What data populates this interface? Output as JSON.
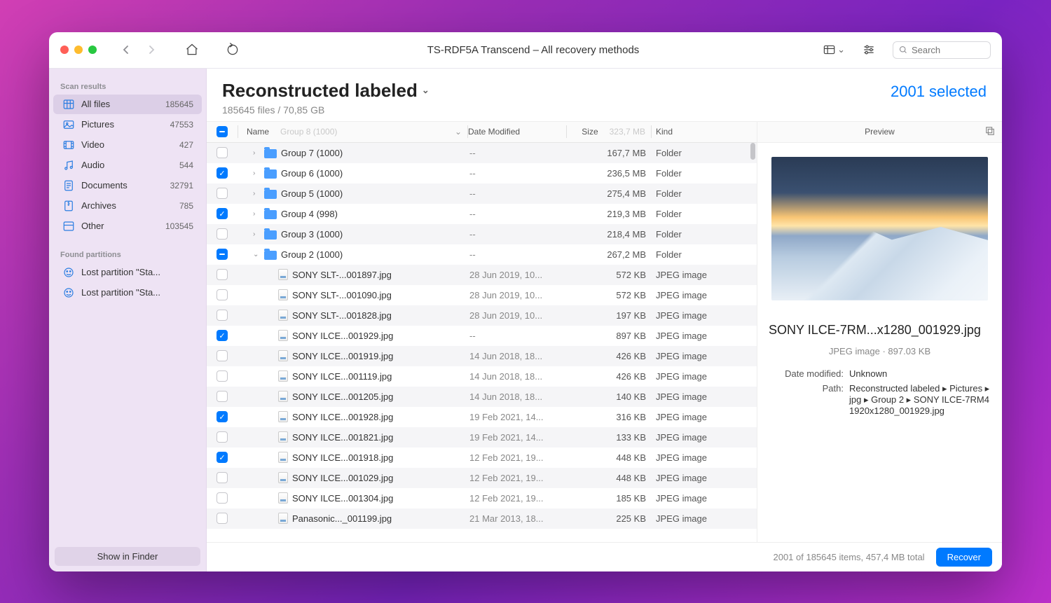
{
  "window": {
    "title": "TS-RDF5A Transcend – All recovery methods"
  },
  "toolbar": {
    "search_placeholder": "Search"
  },
  "sidebar": {
    "section_scan": "Scan results",
    "section_found": "Found partitions",
    "items": [
      {
        "icon": "grid",
        "label": "All files",
        "count": "185645",
        "active": true
      },
      {
        "icon": "picture",
        "label": "Pictures",
        "count": "47553",
        "active": false
      },
      {
        "icon": "video",
        "label": "Video",
        "count": "427",
        "active": false
      },
      {
        "icon": "audio",
        "label": "Audio",
        "count": "544",
        "active": false
      },
      {
        "icon": "document",
        "label": "Documents",
        "count": "32791",
        "active": false
      },
      {
        "icon": "archive",
        "label": "Archives",
        "count": "785",
        "active": false
      },
      {
        "icon": "other",
        "label": "Other",
        "count": "103545",
        "active": false
      }
    ],
    "partitions": [
      {
        "label": "Lost partition \"Sta..."
      },
      {
        "label": "Lost partition \"Sta..."
      }
    ],
    "footer_btn": "Show in Finder"
  },
  "header": {
    "title": "Reconstructed labeled",
    "subtitle": "185645 files / 70,85 GB",
    "selected": "2001 selected"
  },
  "columns": {
    "name": "Name",
    "name_ghost": "Group 8 (1000)",
    "date": "Date Modified",
    "size": "Size",
    "size_ghost": "323,7 MB",
    "kind": "Kind"
  },
  "rows": [
    {
      "check": "none",
      "indent": 1,
      "expand": "right",
      "type": "folder",
      "name": "Group 7 (1000)",
      "date": "--",
      "size": "167,7 MB",
      "kind": "Folder"
    },
    {
      "check": "checked",
      "indent": 1,
      "expand": "right",
      "type": "folder",
      "name": "Group 6 (1000)",
      "date": "--",
      "size": "236,5 MB",
      "kind": "Folder"
    },
    {
      "check": "none",
      "indent": 1,
      "expand": "right",
      "type": "folder",
      "name": "Group 5 (1000)",
      "date": "--",
      "size": "275,4 MB",
      "kind": "Folder"
    },
    {
      "check": "checked",
      "indent": 1,
      "expand": "right",
      "type": "folder",
      "name": "Group 4 (998)",
      "date": "--",
      "size": "219,3 MB",
      "kind": "Folder"
    },
    {
      "check": "none",
      "indent": 1,
      "expand": "right",
      "type": "folder",
      "name": "Group 3 (1000)",
      "date": "--",
      "size": "218,4 MB",
      "kind": "Folder"
    },
    {
      "check": "mixed",
      "indent": 1,
      "expand": "down",
      "type": "folder",
      "name": "Group 2 (1000)",
      "date": "--",
      "size": "267,2 MB",
      "kind": "Folder"
    },
    {
      "check": "none",
      "indent": 2,
      "expand": "",
      "type": "jpg",
      "name": "SONY SLT-...001897.jpg",
      "date": "28 Jun 2019, 10...",
      "size": "572 KB",
      "kind": "JPEG image"
    },
    {
      "check": "none",
      "indent": 2,
      "expand": "",
      "type": "jpg",
      "name": "SONY SLT-...001090.jpg",
      "date": "28 Jun 2019, 10...",
      "size": "572 KB",
      "kind": "JPEG image"
    },
    {
      "check": "none",
      "indent": 2,
      "expand": "",
      "type": "jpg",
      "name": "SONY SLT-...001828.jpg",
      "date": "28 Jun 2019, 10...",
      "size": "197 KB",
      "kind": "JPEG image"
    },
    {
      "check": "checked",
      "indent": 2,
      "expand": "",
      "type": "jpg",
      "name": "SONY ILCE...001929.jpg",
      "date": "--",
      "size": "897 KB",
      "kind": "JPEG image"
    },
    {
      "check": "none",
      "indent": 2,
      "expand": "",
      "type": "jpg",
      "name": "SONY ILCE...001919.jpg",
      "date": "14 Jun 2018, 18...",
      "size": "426 KB",
      "kind": "JPEG image"
    },
    {
      "check": "none",
      "indent": 2,
      "expand": "",
      "type": "jpg",
      "name": "SONY ILCE...001119.jpg",
      "date": "14 Jun 2018, 18...",
      "size": "426 KB",
      "kind": "JPEG image"
    },
    {
      "check": "none",
      "indent": 2,
      "expand": "",
      "type": "jpg",
      "name": "SONY ILCE...001205.jpg",
      "date": "14 Jun 2018, 18...",
      "size": "140 KB",
      "kind": "JPEG image"
    },
    {
      "check": "checked",
      "indent": 2,
      "expand": "",
      "type": "jpg",
      "name": "SONY ILCE...001928.jpg",
      "date": "19 Feb 2021, 14...",
      "size": "316 KB",
      "kind": "JPEG image"
    },
    {
      "check": "none",
      "indent": 2,
      "expand": "",
      "type": "jpg",
      "name": "SONY ILCE...001821.jpg",
      "date": "19 Feb 2021, 14...",
      "size": "133 KB",
      "kind": "JPEG image"
    },
    {
      "check": "checked",
      "indent": 2,
      "expand": "",
      "type": "jpg",
      "name": "SONY ILCE...001918.jpg",
      "date": "12 Feb 2021, 19...",
      "size": "448 KB",
      "kind": "JPEG image"
    },
    {
      "check": "none",
      "indent": 2,
      "expand": "",
      "type": "jpg",
      "name": "SONY ILCE...001029.jpg",
      "date": "12 Feb 2021, 19...",
      "size": "448 KB",
      "kind": "JPEG image"
    },
    {
      "check": "none",
      "indent": 2,
      "expand": "",
      "type": "jpg",
      "name": "SONY ILCE...001304.jpg",
      "date": "12 Feb 2021, 19...",
      "size": "185 KB",
      "kind": "JPEG image"
    },
    {
      "check": "none",
      "indent": 2,
      "expand": "",
      "type": "jpg",
      "name": "Panasonic..._001199.jpg",
      "date": "21 Mar 2013, 18...",
      "size": "225 KB",
      "kind": "JPEG image"
    }
  ],
  "preview": {
    "head": "Preview",
    "title": "SONY ILCE-7RM...x1280_001929.jpg",
    "meta": "JPEG image · 897.03 KB",
    "date_label": "Date modified:",
    "date_value": "Unknown",
    "path_label": "Path:",
    "path_value": "Reconstructed labeled ▸ Pictures ▸ jpg ▸ Group 2 ▸ SONY ILCE-7RM4 1920x1280_001929.jpg"
  },
  "footer": {
    "summary": "2001 of 185645 items, 457,4 MB total",
    "recover": "Recover"
  }
}
